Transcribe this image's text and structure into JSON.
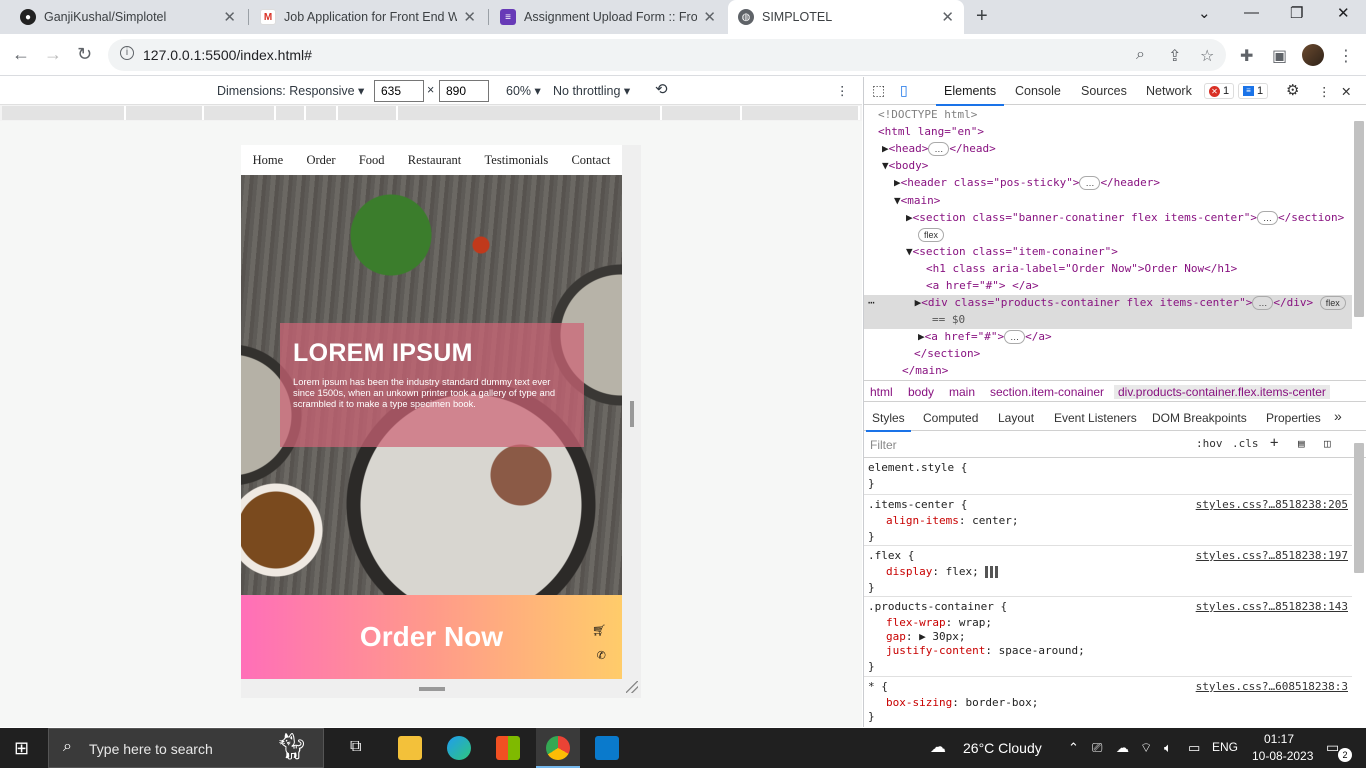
{
  "browser": {
    "tabs": [
      {
        "title": "GanjiKushal/Simplotel",
        "icon": "github-icon"
      },
      {
        "title": "Job Application for Front End We",
        "icon": "gmail-icon"
      },
      {
        "title": "Assignment Upload Form :: Front",
        "icon": "form-icon"
      },
      {
        "title": "SIMPLOTEL",
        "icon": "globe-icon"
      }
    ],
    "url": "127.0.0.1:5500/index.html#"
  },
  "devtoolbar": {
    "dimensions_label": "Dimensions: Responsive",
    "width": "635",
    "height": "890",
    "times": "×",
    "zoom": "60%",
    "throttling": "No throttling"
  },
  "site": {
    "nav": [
      "Home",
      "Order",
      "Food",
      "Restaurant",
      "Testimonials",
      "Contact"
    ],
    "banner_title": "LOREM IPSUM",
    "banner_text": "Lorem ipsum has been the industry standard dummy text ever since 1500s, when an unkown printer took a gallery of type and scrambled it to make a type specimen book.",
    "order_title": "Order Now"
  },
  "devtools": {
    "tabs": [
      "Elements",
      "Console",
      "Sources",
      "Network"
    ],
    "errors": "1",
    "messages": "1",
    "dom": {
      "doctype": "<!DOCTYPE html>",
      "html_open": "<html lang=\"en\">",
      "head": "<head>",
      "head_close": "</head>",
      "body": "<body>",
      "header": "<header class=\"pos-sticky\">",
      "header_close": "</header>",
      "main": "<main>",
      "section1": "<section class=\"banner-conatiner flex items-center\">",
      "section_close": "</section>",
      "flex": "flex",
      "section2": "<section class=\"item-conainer\">",
      "h1": "<h1 class aria-label=\"Order Now\">Order Now</h1>",
      "a1": "<a href=\"#\"> </a>",
      "div": "<div class=\"products-container flex items-center\">",
      "div_close": "</div>",
      "eq": "== $0",
      "a2": "<a href=\"#\">",
      "a2_close": "</a>",
      "section_close2": "</section>",
      "main_close": "</main>"
    },
    "breadcrumbs": [
      "html",
      "body",
      "main",
      "section.item-conainer",
      "div.products-container.flex.items-center"
    ],
    "style_tabs": [
      "Styles",
      "Computed",
      "Layout",
      "Event Listeners",
      "DOM Breakpoints",
      "Properties"
    ],
    "filter_placeholder": "Filter",
    "hov": ":hov",
    "cls": ".cls",
    "rules": [
      {
        "selector": "element.style {",
        "source": "",
        "props": []
      },
      {
        "selector": ".items-center {",
        "source": "styles.css?…8518238:205",
        "props": [
          {
            "name": "align-items",
            "value": "center;"
          }
        ]
      },
      {
        "selector": ".flex {",
        "source": "styles.css?…8518238:197",
        "props": [
          {
            "name": "display",
            "value": "flex;"
          }
        ]
      },
      {
        "selector": ".products-container {",
        "source": "styles.css?…8518238:143",
        "props": [
          {
            "name": "flex-wrap",
            "value": "wrap;"
          },
          {
            "name": "gap",
            "value": "▶ 30px;"
          },
          {
            "name": "justify-content",
            "value": "space-around;"
          }
        ]
      },
      {
        "selector": "* {",
        "source": "styles.css?…608518238:3",
        "props": [
          {
            "name": "box-sizing",
            "value": "border-box;"
          }
        ]
      }
    ],
    "close_brace": "}"
  },
  "taskbar": {
    "search_placeholder": "Type here to search",
    "weather": "26°C  Cloudy",
    "lang": "ENG",
    "time": "01:17",
    "date": "10-08-2023",
    "notifications": "2"
  }
}
